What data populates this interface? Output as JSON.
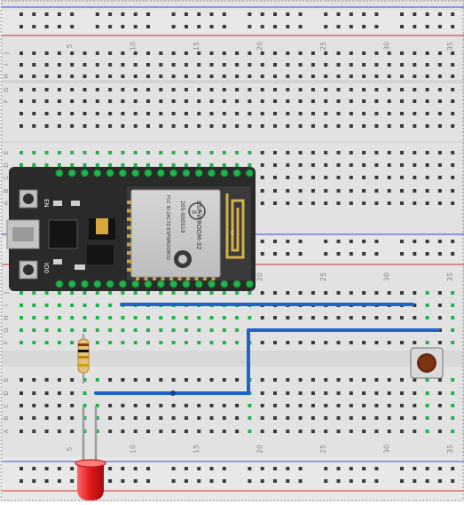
{
  "breadboard": {
    "column_numbers": [
      "5",
      "10",
      "15",
      "20",
      "25",
      "30",
      "35"
    ],
    "row_letters_top": [
      "J",
      "I",
      "H",
      "G",
      "F"
    ],
    "row_letters_bottom": [
      "E",
      "D",
      "C",
      "B",
      "A"
    ]
  },
  "esp32": {
    "module_name": "ESP-WROOM-32",
    "button_en": "EN",
    "button_boot": "IO0",
    "cert_text": "205-000519",
    "fcc_text": "FCC ID:2AC7Z-ESPWROOM32",
    "ce_mark": "CE",
    "brand_mark": "Wi-Fi",
    "antenna_label": "C"
  },
  "components": {
    "resistor": "resistor",
    "led": "red-led",
    "push_button": "push-button"
  },
  "colors": {
    "board": "#e3e3e3",
    "rail_blue": "#2f3fd0",
    "rail_red": "#d02828",
    "wire_blue": "#1f64c8",
    "led_red": "#e02020",
    "highlight_green": "#21b24a",
    "esp_body": "#2a2a2a"
  }
}
